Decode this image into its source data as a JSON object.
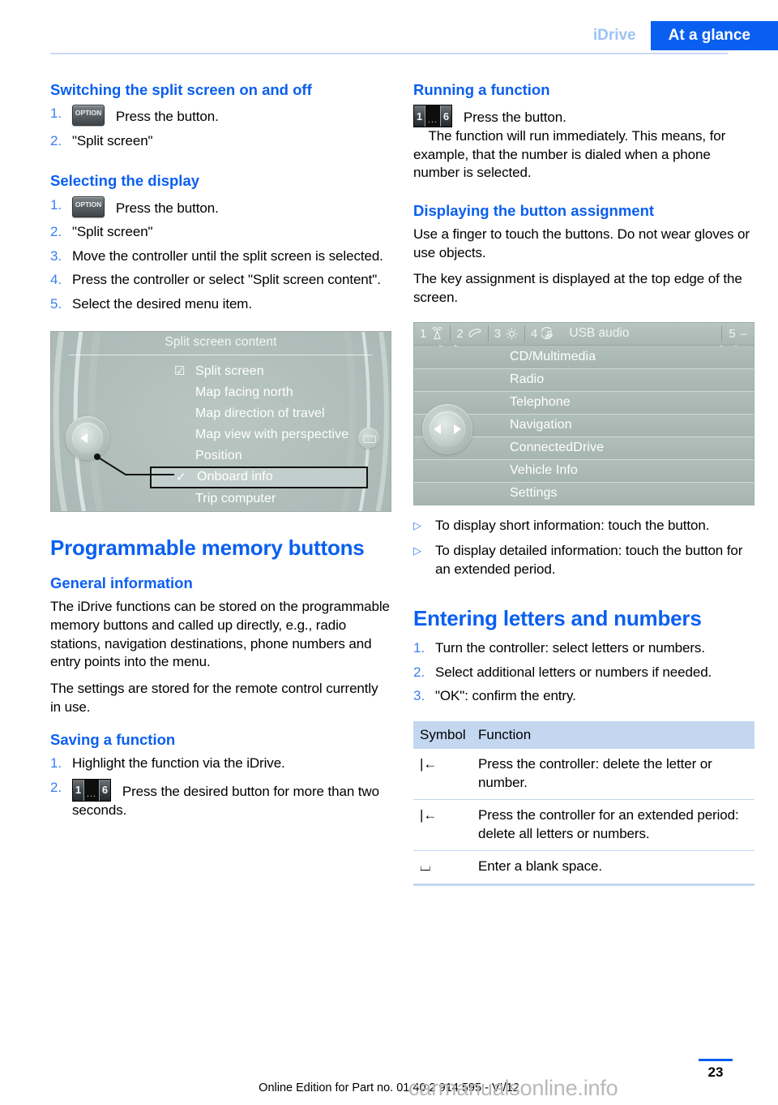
{
  "header": {
    "breadcrumb_chapter": "iDrive",
    "breadcrumb_section": "At a glance"
  },
  "left_column": {
    "section1": {
      "heading": "Switching the split screen on and off",
      "steps": [
        {
          "num": "1.",
          "icon": "option-button-icon",
          "text": "Press the button."
        },
        {
          "num": "2.",
          "text": "\"Split screen\""
        }
      ]
    },
    "section2": {
      "heading": "Selecting the display",
      "steps": [
        {
          "num": "1.",
          "icon": "option-button-icon",
          "text": "Press the button."
        },
        {
          "num": "2.",
          "text": "\"Split screen\""
        },
        {
          "num": "3.",
          "text": "Move the controller until the split screen is selected."
        },
        {
          "num": "4.",
          "text": "Press the controller or select \"Split screen content\"."
        },
        {
          "num": "5.",
          "text": "Select the desired menu item."
        }
      ]
    },
    "figure_split_screen": {
      "title": "Split screen content",
      "items": [
        {
          "mark": "checkbox",
          "label": "Split screen",
          "highlight": false
        },
        {
          "mark": "",
          "label": "Map facing north",
          "highlight": false
        },
        {
          "mark": "",
          "label": "Map direction of travel",
          "highlight": false
        },
        {
          "mark": "",
          "label": "Map view with perspective",
          "highlight": false
        },
        {
          "mark": "",
          "label": "Position",
          "highlight": false
        },
        {
          "mark": "check",
          "label": "Onboard info",
          "highlight": true
        },
        {
          "mark": "",
          "label": "Trip computer",
          "highlight": false
        }
      ]
    },
    "chapter_heading": "Programmable memory buttons",
    "section3": {
      "heading": "General information",
      "paragraphs": [
        "The iDrive functions can be stored on the programmable memory buttons and called up directly, e.g., radio stations, navigation destinations, phone numbers and entry points into the menu.",
        "The settings are stored for the remote control currently in use."
      ]
    },
    "section4": {
      "heading": "Saving a function",
      "steps": [
        {
          "num": "1.",
          "text": "Highlight the function via the iDrive."
        },
        {
          "num": "2.",
          "icon": "memory-buttons-icon",
          "text": "Press the desired button for more than two seconds."
        }
      ]
    }
  },
  "right_column": {
    "section1": {
      "heading": "Running a function",
      "icon": "memory-buttons-icon",
      "lead": "Press the button.",
      "body": "The function will run immediately. This means, for example, that the number is dialed when a phone number is selected."
    },
    "section2": {
      "heading": "Displaying the button assignment",
      "paragraphs": [
        "Use a finger to touch the buttons. Do not wear gloves or use objects.",
        "The key assignment is displayed at the top edge of the screen."
      ]
    },
    "figure_main_menu": {
      "statusbar": {
        "slots": [
          {
            "num": "1",
            "icon": "radio-antenna-icon"
          },
          {
            "num": "2",
            "icon": "phone-handset-icon"
          },
          {
            "num": "3",
            "icon": "gear-icon"
          },
          {
            "num": "4",
            "icon": "music-note-icon"
          }
        ],
        "label": "USB audio",
        "right_num": "5",
        "right_icon": "dash-icon"
      },
      "items": [
        "CD/Multimedia",
        "Radio",
        "Telephone",
        "Navigation",
        "ConnectedDrive",
        "Vehicle Info",
        "Settings"
      ]
    },
    "bullets": [
      "To display short information: touch the button.",
      "To display detailed information: touch the button for an extended period."
    ],
    "chapter_heading": "Entering letters and numbers",
    "steps": [
      {
        "num": "1.",
        "text": "Turn the controller: select letters or numbers."
      },
      {
        "num": "2.",
        "text": "Select additional letters or numbers if needed."
      },
      {
        "num": "3.",
        "text": "\"OK\": confirm the entry."
      }
    ],
    "symbol_table": {
      "headers": [
        "Symbol",
        "Function"
      ],
      "rows": [
        {
          "symbol": "|←",
          "function": "Press the controller: delete the letter or number."
        },
        {
          "symbol": "|←",
          "function": "Press the controller for an extended period: delete all letters or numbers."
        },
        {
          "symbol": "⌴",
          "function": "Enter a blank space."
        }
      ]
    }
  },
  "footer": {
    "page_number": "23",
    "edition": "Online Edition for Part no. 01 40 2 914 595 - VI/12",
    "watermark": "carmanualsonline.info"
  },
  "colors": {
    "accent_blue": "#0a5ff0",
    "tab_inactive": "#9dc4f5",
    "table_header": "#c3d7f0",
    "screen_green": "#aebcb9"
  }
}
